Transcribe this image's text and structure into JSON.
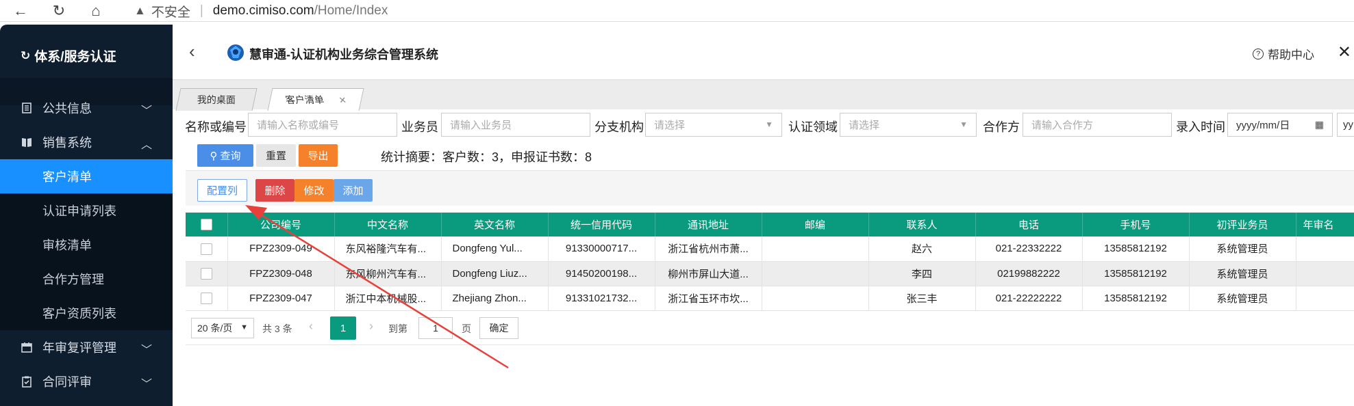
{
  "browser": {
    "security": "不安全",
    "host": "demo.cimiso.com",
    "path": "/Home/Index"
  },
  "sidebar": {
    "brand": "体系/服务认证",
    "items": [
      {
        "label": "公共信息",
        "icon": "document-icon",
        "expanded": false
      },
      {
        "label": "销售系统",
        "icon": "book-icon",
        "expanded": true
      },
      {
        "label": "年审复评管理",
        "icon": "calendar-icon",
        "expanded": false
      },
      {
        "label": "合同评审",
        "icon": "clipboard-icon",
        "expanded": false
      }
    ],
    "sales_sub": [
      "客户清单",
      "认证申请列表",
      "审核清单",
      "合作方管理",
      "客户资质列表"
    ],
    "active_sub": "客户清单"
  },
  "header": {
    "app_title": "慧审通-认证机构业务综合管理系统",
    "help": "帮助中心"
  },
  "tabs": [
    {
      "label": "我的桌面",
      "active": false
    },
    {
      "label": "客户清单",
      "active": true,
      "closable": true
    }
  ],
  "filters": {
    "name_label": "名称或编号",
    "name_placeholder": "请输入名称或编号",
    "sales_label": "业务员",
    "sales_placeholder": "请输入业务员",
    "branch_label": "分支机构",
    "branch_placeholder": "请选择",
    "domain_label": "认证领域",
    "domain_placeholder": "请选择",
    "partner_label": "合作方",
    "partner_placeholder": "请输入合作方",
    "date_label": "录入时间",
    "date_placeholder": "yyyy/mm/日",
    "date2_placeholder": "yy"
  },
  "actions": {
    "query": "查询",
    "reset": "重置",
    "export": "导出",
    "summary": "统计摘要：客户数：3，申报证书数：8",
    "config_columns": "配置列",
    "delete": "删除",
    "edit": "修改",
    "add": "添加"
  },
  "table": {
    "columns": [
      "公司编号",
      "中文名称",
      "英文名称",
      "统一信用代码",
      "通讯地址",
      "邮编",
      "联系人",
      "电话",
      "手机号",
      "初评业务员",
      "年审名"
    ],
    "rows": [
      [
        "FPZ2309-049",
        "东风裕隆汽车有...",
        "Dongfeng Yul...",
        "91330000717...",
        "浙江省杭州市萧...",
        "",
        "赵六",
        "021-22332222",
        "13585812192",
        "系统管理员",
        ""
      ],
      [
        "FPZ2309-048",
        "东风柳州汽车有...",
        "Dongfeng Liuz...",
        "91450200198...",
        "柳州市屏山大道...",
        "",
        "李四",
        "02199882222",
        "13585812192",
        "系统管理员",
        ""
      ],
      [
        "FPZ2309-047",
        "浙江中本机械股...",
        "Zhejiang Zhon...",
        "91331021732...",
        "浙江省玉环市坎...",
        "",
        "张三丰",
        "021-22222222",
        "13585812192",
        "系统管理员",
        ""
      ]
    ]
  },
  "pager": {
    "page_size": "20 条/页",
    "total": "共 3 条",
    "current": "1",
    "goto_label": "到第",
    "goto_value": "1",
    "page_unit": "页",
    "confirm": "确定"
  },
  "colors": {
    "sidebar_bg": "#0f1e2f",
    "active_blue": "#1890ff",
    "table_header": "#0a9b7f",
    "annotation_arrow": "#e8403a"
  }
}
